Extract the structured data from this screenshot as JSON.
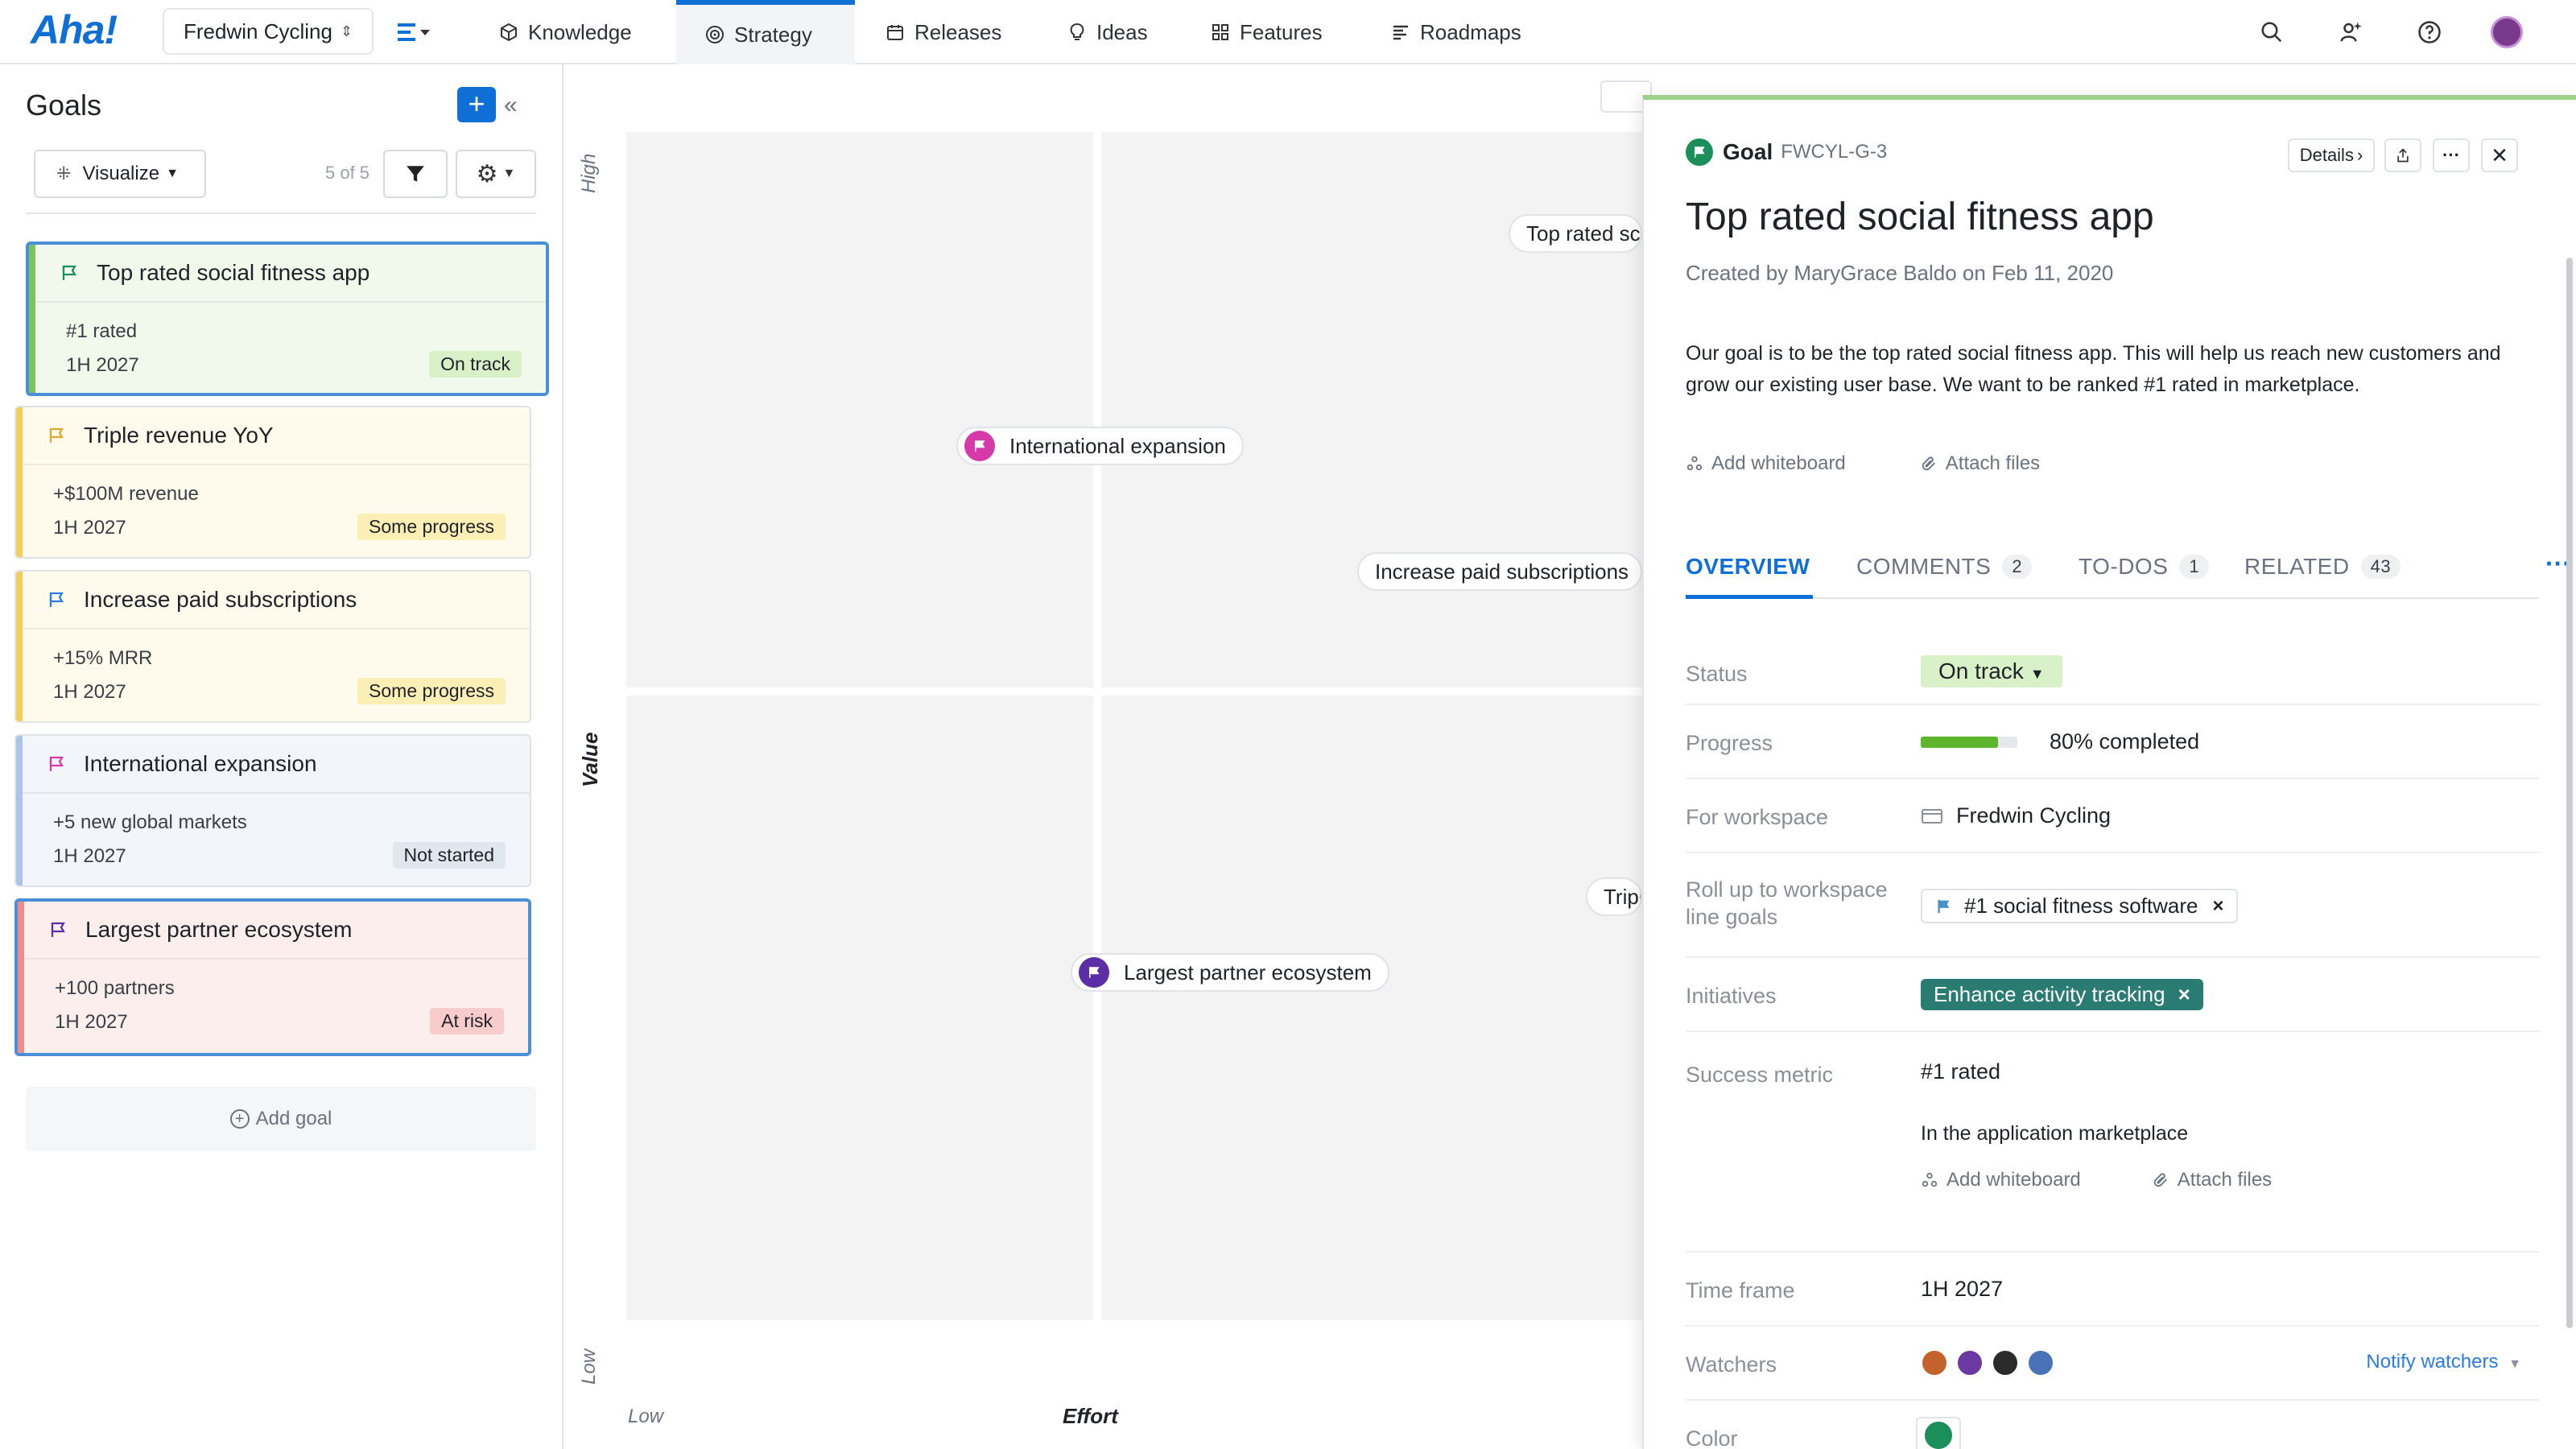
{
  "app": {
    "logo": "Aha!",
    "workspace": "Fredwin Cycling",
    "nav_tabs": [
      {
        "label": "Knowledge",
        "icon": "cube-icon"
      },
      {
        "label": "Strategy",
        "icon": "target-icon"
      },
      {
        "label": "Releases",
        "icon": "calendar-icon"
      },
      {
        "label": "Ideas",
        "icon": "lightbulb-icon"
      },
      {
        "label": "Features",
        "icon": "grid-icon"
      },
      {
        "label": "Roadmaps",
        "icon": "roadmap-icon"
      }
    ],
    "active_tab": "Strategy"
  },
  "sidebar": {
    "title": "Goals",
    "visualize_label": "Visualize",
    "count_label": "5 of 5",
    "add_goal_label": "Add goal",
    "goals": [
      {
        "name": "Top rated social fitness app",
        "metric": "#1 rated",
        "timeframe": "1H 2027",
        "status": "On track",
        "color": "#1a8f5a",
        "bg": "#f1f8ec",
        "badge_bg": "#d9f1c9",
        "bar": "#7cc35c"
      },
      {
        "name": "Triple revenue YoY",
        "metric": "+$100M revenue",
        "timeframe": "1H 2027",
        "status": "Some progress",
        "color": "#e0a82e",
        "bg": "#fefbec",
        "badge_bg": "#fbefb6",
        "bar": "#f3cf5a"
      },
      {
        "name": "Increase paid subscriptions",
        "metric": "+15% MRR",
        "timeframe": "1H 2027",
        "status": "Some progress",
        "color": "#2c7be5",
        "bg": "#fefbec",
        "badge_bg": "#fbefb6",
        "bar": "#f3cf5a"
      },
      {
        "name": "International expansion",
        "metric": "+5 new global markets",
        "timeframe": "1H 2027",
        "status": "Not started",
        "color": "#d63aa8",
        "bg": "#f2f6fb",
        "badge_bg": "#e1e7ef",
        "bar": "#a9c6e8"
      },
      {
        "name": "Largest partner ecosystem",
        "metric": "+100 partners",
        "timeframe": "1H 2027",
        "status": "At risk",
        "color": "#5b2ea6",
        "bg": "#fdeeee",
        "badge_bg": "#f9cccc",
        "bar": "#ef8d8d"
      }
    ]
  },
  "chart": {
    "axis_y_high": "High",
    "axis_y_low": "Low",
    "axis_y_title": "Value",
    "axis_x_low": "Low",
    "axis_x_title": "Effort",
    "pills": [
      {
        "label": "Top rated sc",
        "dot": null
      },
      {
        "label": "International expansion",
        "dot": "#d63aa8"
      },
      {
        "label": "Increase paid subscriptions",
        "dot": null
      },
      {
        "label": "Tripl",
        "dot": null
      },
      {
        "label": "Largest partner ecosystem",
        "dot": "#5b2ea6"
      }
    ]
  },
  "detail": {
    "type_label": "Goal",
    "ref": "FWCYL-G-3",
    "details_label": "Details",
    "title": "Top rated social fitness app",
    "created": "Created by MaryGrace Baldo on Feb 11, 2020",
    "description": "Our goal is to be the top rated social fitness app. This will help us reach new customers and grow our existing user base. We want to be ranked #1 rated in marketplace.",
    "add_whiteboard": "Add whiteboard",
    "attach_files": "Attach files",
    "tabs": [
      {
        "label": "OVERVIEW",
        "count": ""
      },
      {
        "label": "COMMENTS",
        "count": "2"
      },
      {
        "label": "TO-DOS",
        "count": "1"
      },
      {
        "label": "RELATED",
        "count": "43"
      }
    ],
    "fields": {
      "status_label": "Status",
      "status_value": "On track",
      "progress_label": "Progress",
      "progress_value": "80% completed",
      "progress_fraction": 0.8,
      "workspace_label": "For workspace",
      "workspace_value": "Fredwin Cycling",
      "rollup_label": "Roll up to workspace line goals",
      "rollup_value": "#1 social fitness software",
      "initiatives_label": "Initiatives",
      "initiatives_value": "Enhance activity tracking",
      "metric_label": "Success metric",
      "metric_value": "#1 rated",
      "metric_note": "In the application marketplace",
      "timeframe_label": "Time frame",
      "timeframe_value": "1H 2027",
      "watchers_label": "Watchers",
      "notify_label": "Notify watchers",
      "watcher_colors": [
        "#c4622d",
        "#6a3aa2",
        "#2b2b2b",
        "#4a72b8"
      ],
      "color_label": "Color",
      "goal_color": "#1a8f5a"
    }
  }
}
